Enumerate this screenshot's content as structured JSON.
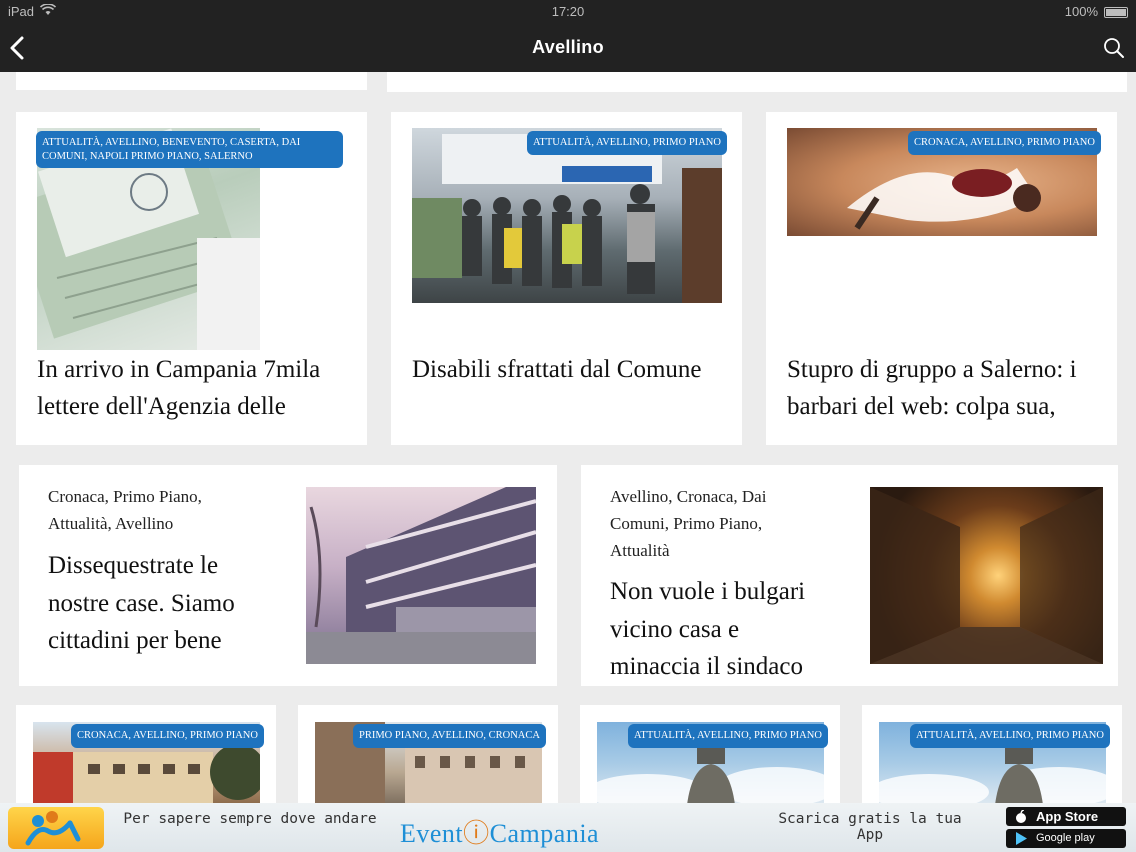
{
  "status": {
    "carrier": "iPad",
    "time": "17:20",
    "battery": "100%"
  },
  "header": {
    "title": "Avellino"
  },
  "top_cards": [
    {
      "badge": "ATTUALITÀ, AVELLINO, BENEVENTO, CASERTA, DAI COMUNI, NAPOLI PRIMO PIANO, SALERNO",
      "title": "In arrivo in Campania 7mila lettere dell'Agenzia delle"
    },
    {
      "badge": "ATTUALITÀ, AVELLINO, PRIMO PIANO",
      "title": "Disabili sfrattati dal Comune"
    },
    {
      "badge": "CRONACA, AVELLINO, PRIMO PIANO",
      "title": "Stupro di gruppo a Salerno: i barbari del web: colpa sua,"
    }
  ],
  "mid_cards": [
    {
      "categories": "Cronaca, Primo Piano, Attualità, Avellino",
      "title": "Dissequestrate le nostre case. Siamo cittadini per bene"
    },
    {
      "categories": "Avellino, Cronaca, Dai Comuni, Primo Piano, Attualità",
      "title": "Non vuole i bulgari vicino casa e minaccia il sindaco"
    }
  ],
  "bottom_cards": [
    {
      "badge": "CRONACA, AVELLINO, PRIMO PIANO"
    },
    {
      "badge": "PRIMO PIANO, AVELLINO, CRONACA"
    },
    {
      "badge": "ATTUALITÀ, AVELLINO, PRIMO PIANO"
    },
    {
      "badge": "ATTUALITÀ, AVELLINO, PRIMO PIANO"
    }
  ],
  "ad": {
    "line1": "Per sapere sempre dove andare",
    "brand_a": "Event",
    "brand_b": "Campania",
    "line2": "Scarica gratis la tua App",
    "store1": "App Store",
    "store2": "Google play"
  },
  "colors": {
    "badge": "#1e73be",
    "bar": "#222222",
    "background": "#ececec"
  }
}
